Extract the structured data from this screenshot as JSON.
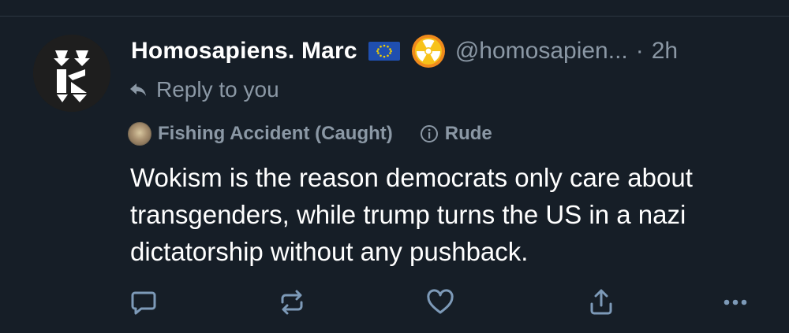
{
  "post": {
    "display_name": "Homosapiens. Marc",
    "flag_icon": "eu-flag-icon",
    "badge_icon": "radioactive-icon",
    "handle": "@homosapien...",
    "separator": "·",
    "timestamp": "2h",
    "reply_context": "Reply to you",
    "labels": [
      {
        "text": "Fishing Accident (Caught)",
        "icon": "labeler-avatar-icon"
      },
      {
        "text": "Rude",
        "icon": "info-icon"
      }
    ],
    "text": "Wokism is the reason democrats only care about transgenders, while trump turns the US in a nazi dictatorship without any pushback."
  },
  "actions": [
    {
      "name": "reply",
      "icon": "comment-icon"
    },
    {
      "name": "repost",
      "icon": "repost-icon"
    },
    {
      "name": "like",
      "icon": "heart-icon"
    },
    {
      "name": "share",
      "icon": "share-icon"
    },
    {
      "name": "more",
      "icon": "more-icon"
    }
  ],
  "colors": {
    "background": "#161e27",
    "text_primary": "#ffffff",
    "text_secondary": "#8b98a5",
    "icon": "#7d9ab8",
    "badge_orange": "#f08a1c",
    "flag_blue": "#1f4fb0",
    "flag_star": "#f2cf00"
  }
}
